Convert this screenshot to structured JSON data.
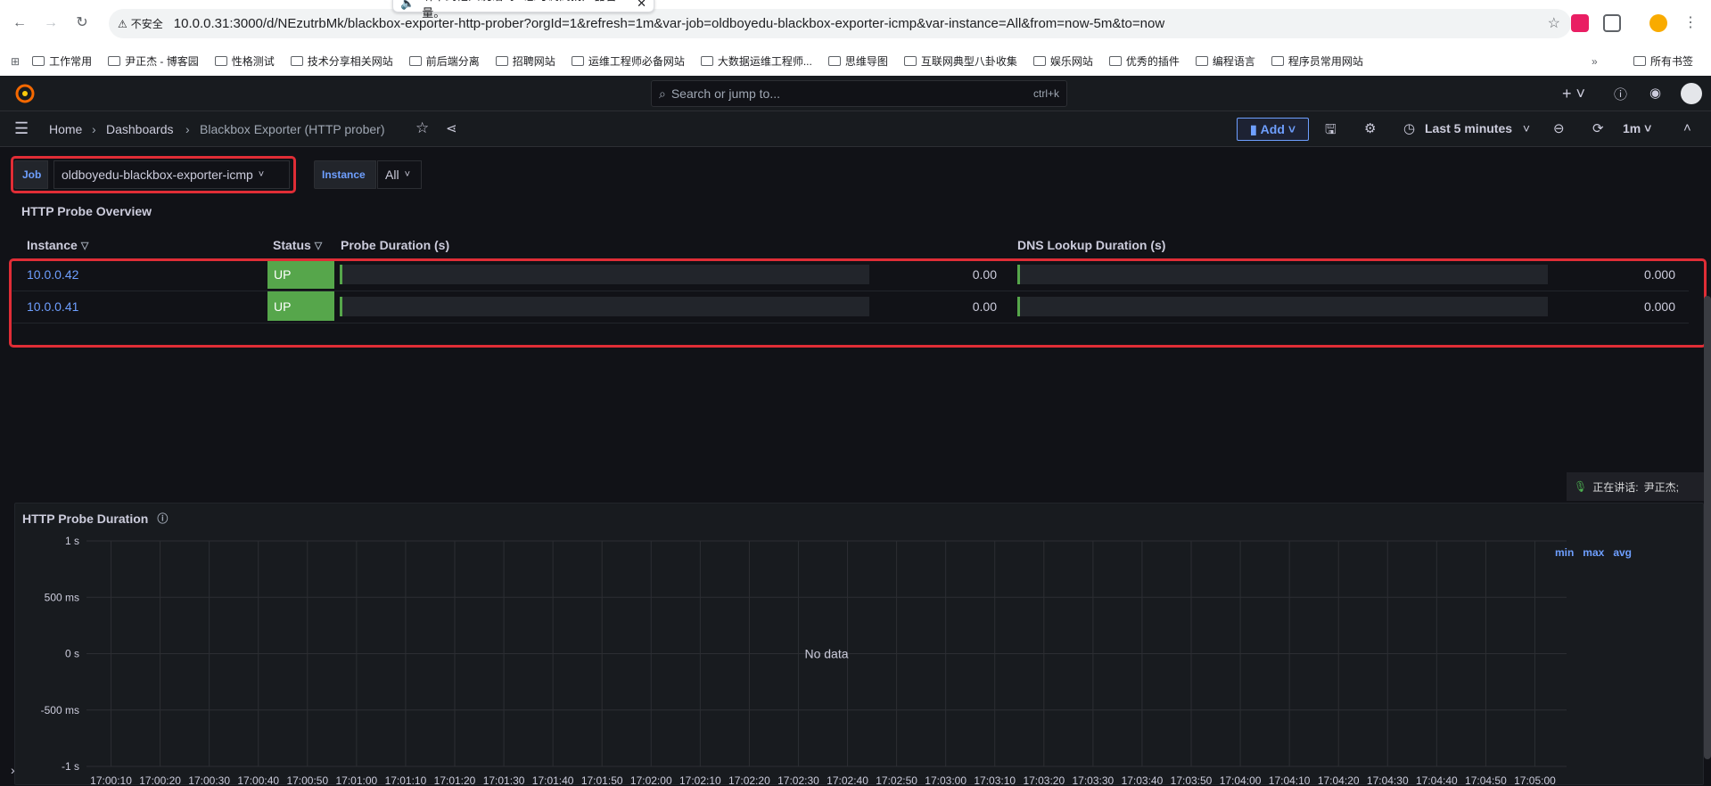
{
  "browser": {
    "url": "10.0.0.31:3000/d/NEzutrbMk/blackbox-exporter-http-prober?orgId=1&refresh=1m&var-job=oldboyedu-blackbox-exporter-icmp&var-instance=All&from=now-5m&to=now",
    "insecure_label": "不安全",
    "toast_text": "听不到他人说话吗? 您可调高扬声器音量。",
    "bookmarks": [
      "工作常用",
      "尹正杰 - 博客园",
      "性格测试",
      "技术分享相关网站",
      "前后端分离",
      "招聘网站",
      "运维工程师必备网站",
      "大数据运维工程师...",
      "思维导图",
      "互联网典型八卦收集",
      "娱乐网站",
      "优秀的插件",
      "编程语言",
      "程序员常用网站"
    ],
    "all_bookmarks": "所有书签"
  },
  "topnav": {
    "search_placeholder": "Search or jump to...",
    "search_shortcut": "ctrl+k"
  },
  "breadcrumb": {
    "home": "Home",
    "dashboards": "Dashboards",
    "current": "Blackbox Exporter (HTTP prober)"
  },
  "toolbar": {
    "add_label": "Add",
    "time_range": "Last 5 minutes",
    "refresh_interval": "1m"
  },
  "variables": {
    "job_label": "Job",
    "job_value": "oldboyedu-blackbox-exporter-icmp",
    "instance_label": "Instance",
    "instance_value": "All"
  },
  "table_panel": {
    "title": "HTTP Probe Overview",
    "columns": [
      "Instance",
      "Status",
      "Probe Duration (s)",
      "DNS Lookup Duration (s)"
    ],
    "rows": [
      {
        "instance": "10.0.0.42",
        "status": "UP",
        "probe_duration": "0.00",
        "dns_duration": "0.000"
      },
      {
        "instance": "10.0.0.41",
        "status": "UP",
        "probe_duration": "0.00",
        "dns_duration": "0.000"
      }
    ]
  },
  "speaking": {
    "label": "正在讲话:",
    "name": "尹正杰;"
  },
  "chart_panel": {
    "title": "HTTP Probe Duration",
    "no_data": "No data",
    "legend_stats": [
      "min",
      "max",
      "avg"
    ]
  },
  "chart_data": {
    "type": "line",
    "title": "HTTP Probe Duration",
    "y_ticks": [
      "1 s",
      "500 ms",
      "0 s",
      "-500 ms",
      "-1 s"
    ],
    "ylim": [
      -1,
      1
    ],
    "x_ticks": [
      "17:00:10",
      "17:00:20",
      "17:00:30",
      "17:00:40",
      "17:00:50",
      "17:01:00",
      "17:01:10",
      "17:01:20",
      "17:01:30",
      "17:01:40",
      "17:01:50",
      "17:02:00",
      "17:02:10",
      "17:02:20",
      "17:02:30",
      "17:02:40",
      "17:02:50",
      "17:03:00",
      "17:03:10",
      "17:03:20",
      "17:03:30",
      "17:03:40",
      "17:03:50",
      "17:04:00",
      "17:04:10",
      "17:04:20",
      "17:04:30",
      "17:04:40",
      "17:04:50",
      "17:05:00"
    ],
    "series": [],
    "grid": true
  }
}
